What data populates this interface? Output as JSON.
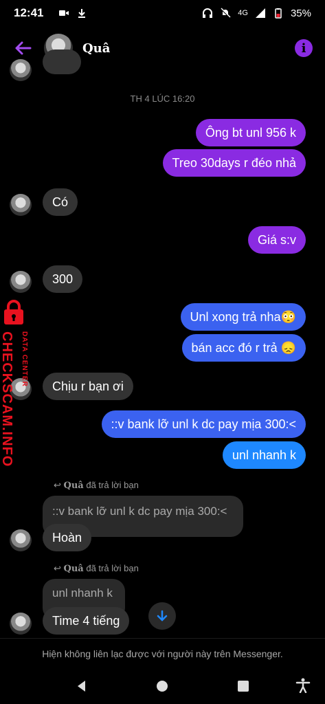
{
  "status": {
    "time": "12:41",
    "network": "4G",
    "battery": "35%"
  },
  "header": {
    "name": "Quâ"
  },
  "chat": {
    "date_divider": "TH 4 LÚC 16:20",
    "messages": [
      {
        "text": "Ông bt unl 956 k"
      },
      {
        "text": "Treo 30days r đéo nhả"
      },
      {
        "text": "Có"
      },
      {
        "text": "Giá s:v"
      },
      {
        "text": "300"
      },
      {
        "text": "Unl xong trả nha😳"
      },
      {
        "text": "bán acc đó r trả 😞"
      },
      {
        "text": "Chịu r bạn ơi"
      },
      {
        "text": "::v bank lỡ unl k dc pay mịa 300:<"
      },
      {
        "text": "unl nhanh k"
      },
      {
        "text": "Hoàn"
      },
      {
        "text": "Time 4 tiếng"
      }
    ],
    "reply_1": {
      "who": "Quâ",
      "label": "đã trả lời bạn",
      "quoted": "::v bank lỡ unl k dc pay mịa 300:<"
    },
    "reply_2": {
      "who": "Quâ",
      "label": "đã trả lời bạn",
      "quoted": "unl nhanh k"
    }
  },
  "notice": "Hiện không liên lạc được với người này trên Messenger.",
  "watermark": {
    "brand": "CHECKSCAM.INFO",
    "sub": "DATA CENTER"
  },
  "colors": {
    "outgoing_purple": "#8a2be2",
    "outgoing_blue": "#3b62f0",
    "incoming": "#333333",
    "watermark": "#e8121f"
  }
}
